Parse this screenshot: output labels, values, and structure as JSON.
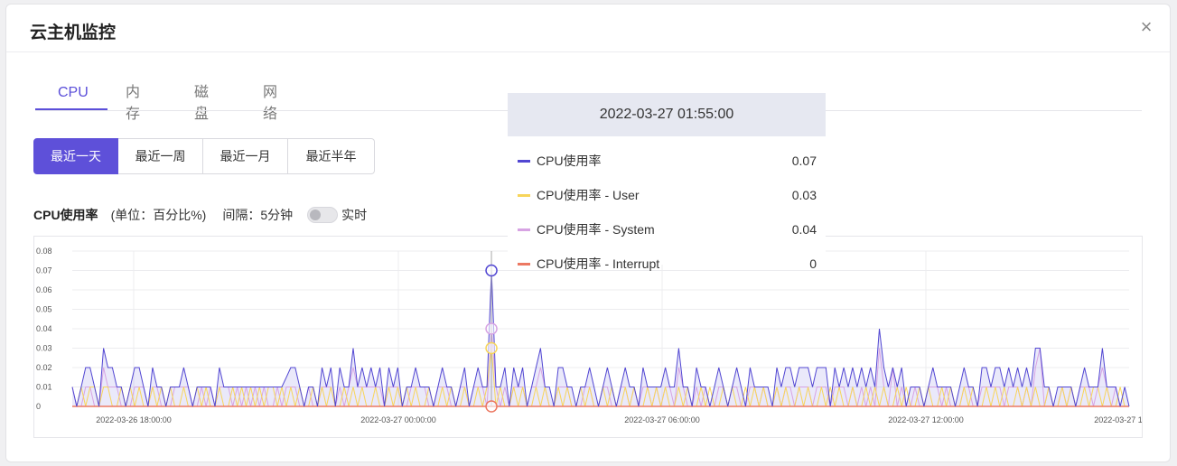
{
  "modal": {
    "title": "云主机监控",
    "close_icon": "close-icon",
    "close_glyph": "×"
  },
  "tabs": [
    {
      "label": "CPU",
      "active": true
    },
    {
      "label": "内存",
      "active": false
    },
    {
      "label": "磁盘",
      "active": false
    },
    {
      "label": "网络",
      "active": false
    }
  ],
  "time_ranges": [
    {
      "label": "最近一天",
      "active": true
    },
    {
      "label": "最近一周",
      "active": false
    },
    {
      "label": "最近一月",
      "active": false
    },
    {
      "label": "最近半年",
      "active": false
    }
  ],
  "metric": {
    "name": "CPU使用率",
    "unit": "(单位：百分比%)",
    "interval": "间隔：5分钟",
    "realtime_label": "实时",
    "realtime_on": false
  },
  "colors": {
    "accent": "#5b4fd9",
    "cpu": "#5146d2",
    "user": "#f7d55a",
    "system": "#d7a3e3",
    "interrupt": "#ec7862"
  },
  "tooltip": {
    "time": "2022-03-27 01:55:00",
    "rows": [
      {
        "label": "CPU使用率",
        "value": "0.07",
        "color": "#5146d2"
      },
      {
        "label": "CPU使用率 - User",
        "value": "0.03",
        "color": "#f7d55a"
      },
      {
        "label": "CPU使用率 - System",
        "value": "0.04",
        "color": "#d7a3e3"
      },
      {
        "label": "CPU使用率 - Interrupt",
        "value": "0",
        "color": "#ec7862"
      }
    ]
  },
  "chart_data": {
    "type": "area",
    "x_ticks": [
      "2022-03-26 18:00:00",
      "2022-03-27 00:00:00",
      "2022-03-27 06:00:00",
      "2022-03-27 12:00:00",
      "2022-03-27 1"
    ],
    "y_ticks": [
      "0",
      "0.01",
      "0.02",
      "0.03",
      "0.04",
      "0.05",
      "0.06",
      "0.07",
      "0.08"
    ],
    "ylim": [
      0,
      0.08
    ],
    "highlight_index": 94,
    "series": [
      {
        "name": "CPU使用率",
        "color": "#5146d2",
        "values": [
          0.01,
          0,
          0.01,
          0.02,
          0.02,
          0.01,
          0,
          0.03,
          0.02,
          0.02,
          0.01,
          0.01,
          0,
          0.01,
          0.02,
          0.02,
          0.01,
          0,
          0.02,
          0.01,
          0.01,
          0,
          0.01,
          0.01,
          0.01,
          0.02,
          0.01,
          0,
          0.01,
          0.01,
          0.01,
          0.01,
          0,
          0.02,
          0.01,
          0.01,
          0.01,
          0.01,
          0.01,
          0.01,
          0.01,
          0.01,
          0.01,
          0.01,
          0.01,
          0.01,
          0.01,
          0.01,
          0.015,
          0.02,
          0.02,
          0.01,
          0,
          0.01,
          0.01,
          0,
          0.02,
          0.01,
          0.02,
          0,
          0.02,
          0.01,
          0.01,
          0.03,
          0.01,
          0.02,
          0.01,
          0.02,
          0.01,
          0.02,
          0,
          0.02,
          0.01,
          0.02,
          0,
          0.01,
          0.01,
          0.02,
          0.01,
          0.01,
          0.01,
          0,
          0.01,
          0.02,
          0.01,
          0.01,
          0,
          0.01,
          0.02,
          0,
          0.01,
          0.02,
          0.01,
          0.01,
          0.07,
          0.01,
          0.01,
          0.02,
          0,
          0.02,
          0.01,
          0.02,
          0,
          0.01,
          0.02,
          0.03,
          0.01,
          0.01,
          0,
          0.02,
          0.02,
          0.01,
          0.01,
          0,
          0.01,
          0.01,
          0.02,
          0.01,
          0,
          0.01,
          0.02,
          0.01,
          0,
          0.01,
          0.02,
          0.01,
          0.01,
          0,
          0.02,
          0.01,
          0.01,
          0.01,
          0.01,
          0.02,
          0.01,
          0.01,
          0.03,
          0.01,
          0.01,
          0,
          0.02,
          0.01,
          0.01,
          0,
          0.01,
          0.02,
          0.01,
          0,
          0.01,
          0.02,
          0.01,
          0,
          0.02,
          0.01,
          0.01,
          0.01,
          0.01,
          0,
          0.02,
          0.01,
          0.02,
          0.02,
          0.01,
          0.02,
          0.02,
          0.02,
          0.01,
          0.02,
          0.02,
          0.02,
          0,
          0.02,
          0.01,
          0.02,
          0.01,
          0.02,
          0.01,
          0.02,
          0.01,
          0.02,
          0.01,
          0.04,
          0.02,
          0.01,
          0.02,
          0.01,
          0.02,
          0,
          0.01,
          0.01,
          0.01,
          0,
          0.01,
          0.02,
          0.01,
          0.01,
          0.01,
          0.01,
          0,
          0.01,
          0.02,
          0.01,
          0.01,
          0,
          0.02,
          0.02,
          0.01,
          0.02,
          0.02,
          0.01,
          0.02,
          0.01,
          0.02,
          0.01,
          0.02,
          0.01,
          0.03,
          0.03,
          0.01,
          0.01,
          0,
          0.01,
          0.01,
          0.01,
          0.01,
          0,
          0.01,
          0.02,
          0.01,
          0.01,
          0.01,
          0.03,
          0.01,
          0.01,
          0.01,
          0,
          0.01,
          0
        ]
      },
      {
        "name": "CPU使用率 - User",
        "color": "#f7d55a",
        "values": [
          0,
          0,
          0.01,
          0,
          0.01,
          0.01,
          0,
          0.01,
          0.01,
          0,
          0,
          0.01,
          0,
          0.01,
          0,
          0.01,
          0,
          0,
          0.01,
          0,
          0.01,
          0,
          0.01,
          0,
          0,
          0.01,
          0,
          0,
          0.01,
          0,
          0.01,
          0,
          0,
          0.01,
          0,
          0,
          0.01,
          0,
          0.01,
          0,
          0.01,
          0,
          0.01,
          0,
          0.01,
          0.01,
          0,
          0.01,
          0,
          0.01,
          0,
          0.01,
          0,
          0,
          0.01,
          0,
          0.01,
          0,
          0.01,
          0,
          0,
          0.01,
          0,
          0.01,
          0,
          0.01,
          0,
          0,
          0.01,
          0,
          0,
          0.01,
          0,
          0.01,
          0,
          0.01,
          0,
          0.01,
          0,
          0,
          0.01,
          0,
          0,
          0.01,
          0,
          0.01,
          0,
          0,
          0.01,
          0,
          0,
          0.01,
          0,
          0.01,
          0.03,
          0,
          0.01,
          0,
          0,
          0.01,
          0,
          0.01,
          0,
          0,
          0.01,
          0,
          0.01,
          0,
          0,
          0.01,
          0,
          0.01,
          0,
          0,
          0.01,
          0,
          0.01,
          0,
          0,
          0.01,
          0,
          0.01,
          0,
          0,
          0.01,
          0,
          0.01,
          0,
          0,
          0.01,
          0,
          0.01,
          0,
          0.01,
          0,
          0,
          0.01,
          0,
          0.01,
          0,
          0,
          0.01,
          0,
          0.01,
          0,
          0,
          0.01,
          0,
          0.01,
          0,
          0,
          0.01,
          0,
          0.01,
          0,
          0.01,
          0,
          0,
          0.01,
          0,
          0.01,
          0,
          0,
          0.01,
          0,
          0.01,
          0,
          0,
          0.01,
          0,
          0.01,
          0,
          0.01,
          0,
          0,
          0.01,
          0,
          0,
          0.01,
          0,
          0.01,
          0,
          0.01,
          0,
          0,
          0.01,
          0,
          0.01,
          0,
          0,
          0.01,
          0,
          0.01,
          0,
          0,
          0.01,
          0,
          0.01,
          0,
          0,
          0.01,
          0,
          0.01,
          0,
          0,
          0.01,
          0,
          0.01,
          0,
          0.01,
          0,
          0,
          0.01,
          0,
          0.01,
          0,
          0.01,
          0,
          0,
          0.01,
          0,
          0,
          0.01,
          0,
          0.01,
          0,
          0,
          0.01,
          0,
          0.01,
          0.01,
          0,
          0.01,
          0,
          0,
          0.01,
          0
        ]
      },
      {
        "name": "CPU使用率 - System",
        "color": "#d7a3e3",
        "values": [
          0.01,
          0,
          0,
          0.01,
          0.01,
          0,
          0,
          0.02,
          0.01,
          0.01,
          0.01,
          0,
          0,
          0,
          0.01,
          0.01,
          0.01,
          0,
          0.01,
          0.01,
          0,
          0,
          0,
          0.01,
          0.01,
          0.01,
          0.01,
          0,
          0,
          0.01,
          0,
          0.01,
          0,
          0.01,
          0.01,
          0.01,
          0,
          0.01,
          0,
          0.01,
          0,
          0.01,
          0,
          0.01,
          0,
          0,
          0.01,
          0,
          0.01,
          0.01,
          0.01,
          0,
          0,
          0.01,
          0,
          0,
          0.01,
          0.01,
          0.01,
          0,
          0.01,
          0,
          0.01,
          0.02,
          0.01,
          0.01,
          0.01,
          0.01,
          0.01,
          0.01,
          0,
          0.01,
          0.01,
          0.01,
          0,
          0,
          0.01,
          0.01,
          0.01,
          0.01,
          0,
          0,
          0.01,
          0.01,
          0.01,
          0,
          0,
          0.01,
          0.01,
          0,
          0.01,
          0.01,
          0.01,
          0,
          0.04,
          0.01,
          0,
          0.01,
          0,
          0.01,
          0.01,
          0.01,
          0,
          0.01,
          0.01,
          0.02,
          0.01,
          0,
          0,
          0.01,
          0.01,
          0.01,
          0,
          0,
          0,
          0.01,
          0.01,
          0,
          0,
          0.01,
          0.01,
          0,
          0,
          0.01,
          0.01,
          0,
          0.01,
          0,
          0.01,
          0.01,
          0,
          0.01,
          0,
          0.01,
          0.01,
          0,
          0.02,
          0.01,
          0,
          0,
          0.01,
          0,
          0.01,
          0,
          0,
          0.01,
          0.01,
          0,
          0.01,
          0.01,
          0,
          0,
          0.01,
          0.01,
          0,
          0.01,
          0,
          0,
          0.01,
          0,
          0.01,
          0.01,
          0,
          0.01,
          0.01,
          0.01,
          0,
          0.01,
          0.01,
          0.01,
          0,
          0.01,
          0.01,
          0.01,
          0,
          0.01,
          0,
          0.01,
          0,
          0.01,
          0,
          0.03,
          0.01,
          0,
          0.02,
          0,
          0.01,
          0,
          0,
          0.01,
          0,
          0,
          0.01,
          0.01,
          0.01,
          0,
          0.01,
          0,
          0,
          0,
          0.01,
          0.01,
          0,
          0,
          0.01,
          0.01,
          0.01,
          0.01,
          0.01,
          0,
          0.01,
          0.01,
          0.01,
          0,
          0.01,
          0,
          0.02,
          0.03,
          0,
          0.01,
          0,
          0,
          0.01,
          0,
          0.01,
          0,
          0.01,
          0.01,
          0.01,
          0,
          0.01,
          0.02,
          0.01,
          0,
          0.01,
          0,
          0,
          0
        ]
      },
      {
        "name": "CPU使用率 - Interrupt",
        "color": "#ec7862",
        "values": []
      }
    ]
  }
}
